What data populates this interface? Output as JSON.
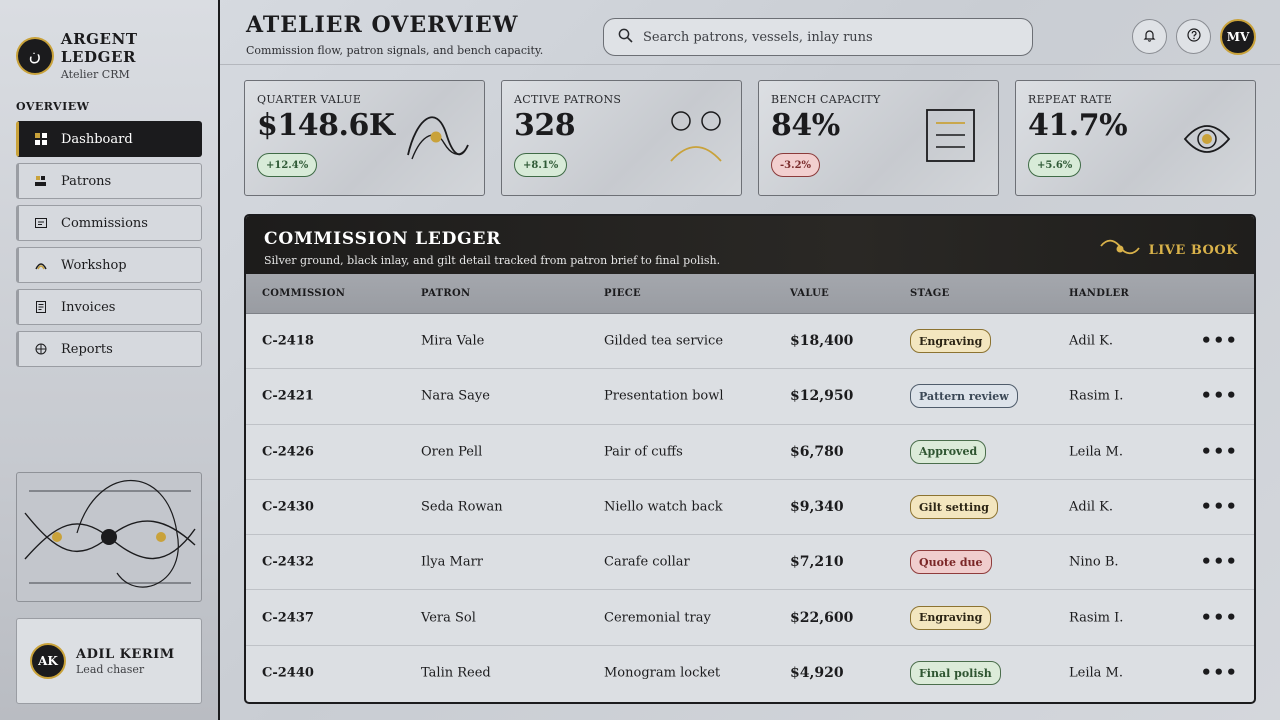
{
  "brand": {
    "mark": "ن",
    "name": "ARGENT LEDGER",
    "sub": "Atelier CRM"
  },
  "nav": {
    "heading": "OVERVIEW",
    "items": [
      {
        "label": "Dashboard",
        "icon": "grid-icon",
        "active": true
      },
      {
        "label": "Patrons",
        "icon": "users-icon"
      },
      {
        "label": "Commissions",
        "icon": "message-icon"
      },
      {
        "label": "Workshop",
        "icon": "arc-icon"
      },
      {
        "label": "Invoices",
        "icon": "document-icon"
      },
      {
        "label": "Reports",
        "icon": "target-icon"
      }
    ]
  },
  "user": {
    "initials": "AK",
    "name": "ADIL KERIM",
    "role": "Lead chaser"
  },
  "header": {
    "title": "ATELIER OVERVIEW",
    "subtitle": "Commission flow, patron signals, and bench capacity.",
    "search_placeholder": "Search patrons, vessels, inlay runs",
    "avatar": "MV"
  },
  "kpis": [
    {
      "label": "QUARTER VALUE",
      "value": "$148.6K",
      "delta": "+12.4%",
      "trend": "up"
    },
    {
      "label": "ACTIVE PATRONS",
      "value": "328",
      "delta": "+8.1%",
      "trend": "up"
    },
    {
      "label": "BENCH CAPACITY",
      "value": "84%",
      "delta": "-3.2%",
      "trend": "down"
    },
    {
      "label": "REPEAT RATE",
      "value": "41.7%",
      "delta": "+5.6%",
      "trend": "up"
    }
  ],
  "ledger": {
    "title": "COMMISSION LEDGER",
    "subtitle": "Silver ground, black inlay, and gilt detail tracked from patron brief to final polish.",
    "live_label": "LIVE BOOK",
    "columns": [
      "COMMISSION",
      "PATRON",
      "PIECE",
      "VALUE",
      "STAGE",
      "HANDLER"
    ],
    "rows": [
      {
        "id": "C-2418",
        "patron": "Mira Vale",
        "piece": "Gilded tea service",
        "value": "$18,400",
        "stage": "Engraving",
        "handler": "Adil K."
      },
      {
        "id": "C-2421",
        "patron": "Nara Saye",
        "piece": "Presentation bowl",
        "value": "$12,950",
        "stage": "Pattern review",
        "handler": "Rasim I."
      },
      {
        "id": "C-2426",
        "patron": "Oren Pell",
        "piece": "Pair of cuffs",
        "value": "$6,780",
        "stage": "Approved",
        "handler": "Leila M."
      },
      {
        "id": "C-2430",
        "patron": "Seda Rowan",
        "piece": "Niello watch back",
        "value": "$9,340",
        "stage": "Gilt setting",
        "handler": "Adil K."
      },
      {
        "id": "C-2432",
        "patron": "Ilya Marr",
        "piece": "Carafe collar",
        "value": "$7,210",
        "stage": "Quote due",
        "handler": "Nino B."
      },
      {
        "id": "C-2437",
        "patron": "Vera Sol",
        "piece": "Ceremonial tray",
        "value": "$22,600",
        "stage": "Engraving",
        "handler": "Rasim I."
      },
      {
        "id": "C-2440",
        "patron": "Talin Reed",
        "piece": "Monogram locket",
        "value": "$4,920",
        "stage": "Final polish",
        "handler": "Leila M."
      }
    ]
  },
  "colors": {
    "ink": "#1b1b1d",
    "gilt": "#c9a23a",
    "silver": "#d6d9de"
  }
}
